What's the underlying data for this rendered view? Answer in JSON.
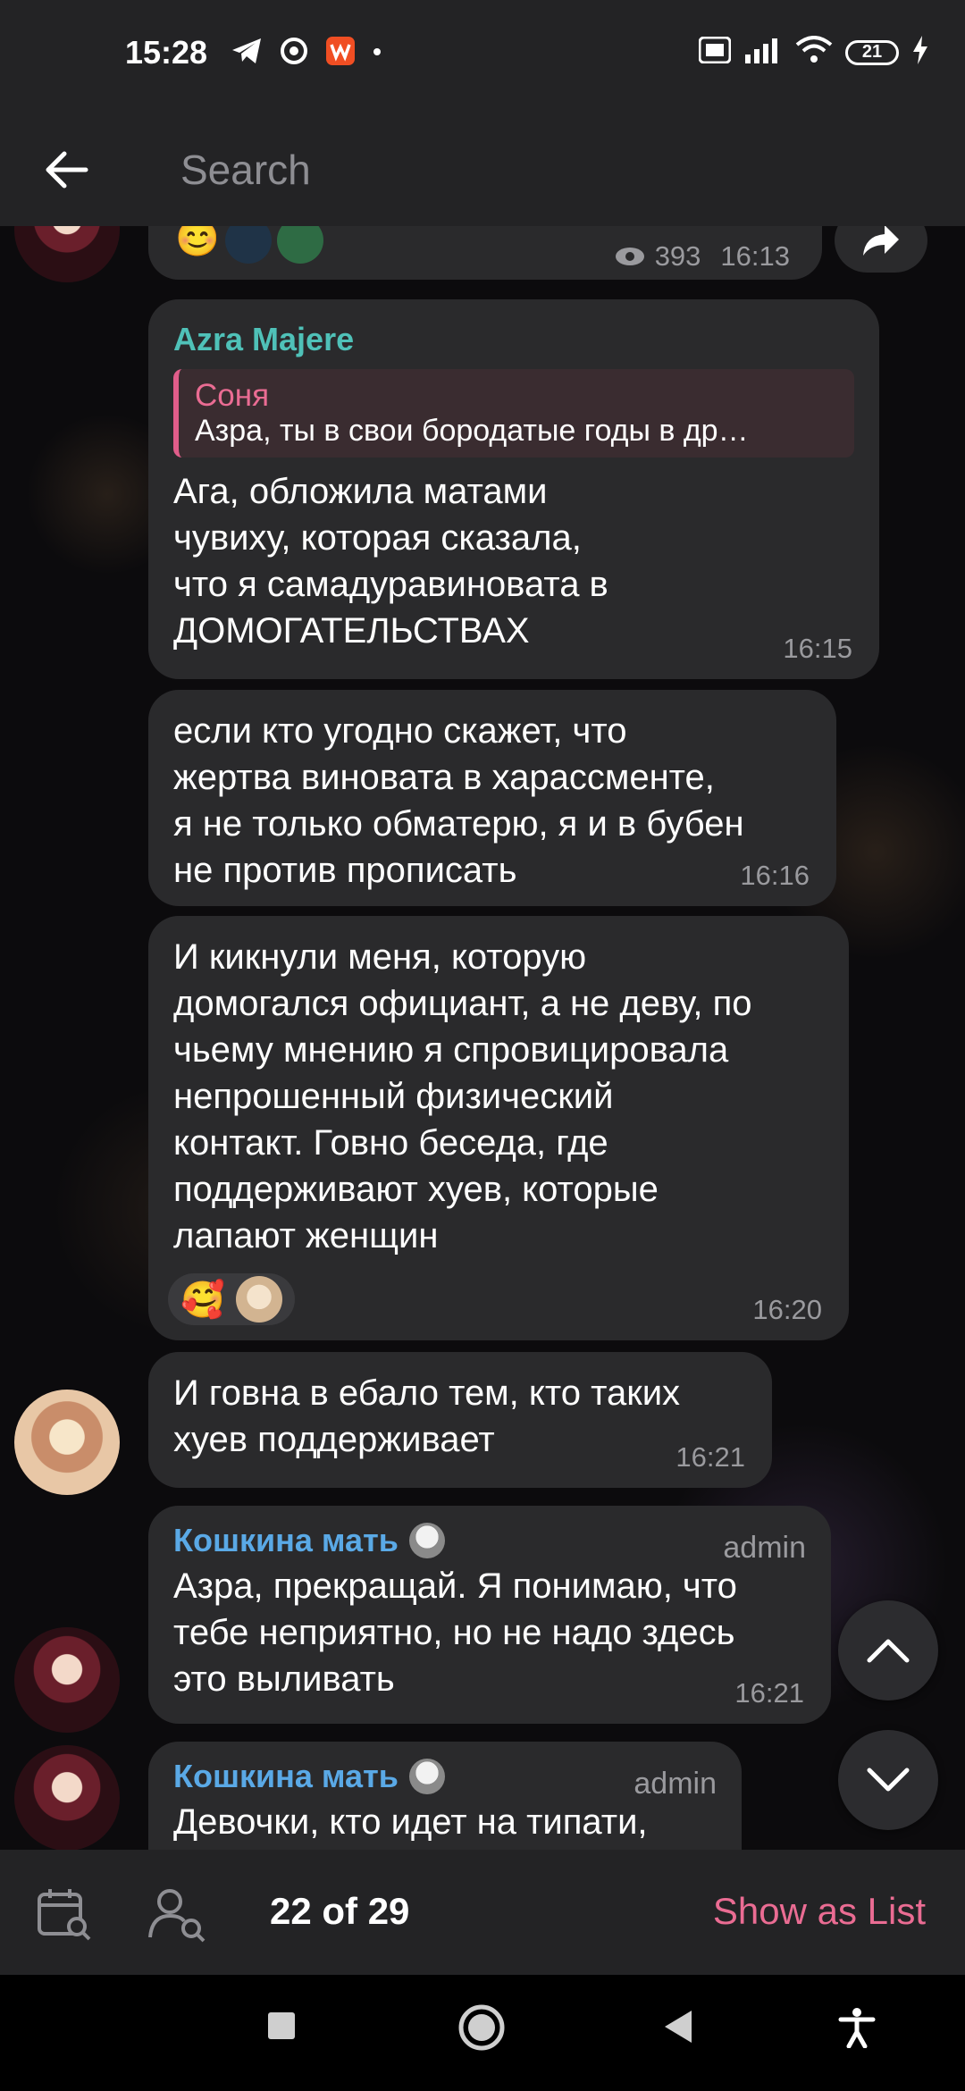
{
  "status_bar": {
    "time": "15:28",
    "battery": "21"
  },
  "header": {
    "search_placeholder": "Search"
  },
  "messages": {
    "m0": {
      "views": "393",
      "time": "16:13"
    },
    "m1": {
      "sender": "Azra Majere",
      "sender_color": "#4fc1b8",
      "quote_name": "Соня",
      "quote_text": "Азра, ты в свои бородатые годы в др…",
      "text": "Ага, обложила матами\nчувиху, которая сказала,\nчто я самадуравиновата в\nДОМОГАТЕЛЬСТВАХ",
      "time": "16:15"
    },
    "m2": {
      "text": "если кто угодно скажет, что\nжертва виновата в харассменте,\nя не только обматерю, я и в бубен\nне против прописать",
      "time": "16:16"
    },
    "m3": {
      "text": "И кикнули меня, которую\nдомогался официант, а не деву, по\nчьему мнению я спровицировала\nнепрошенный физический\nконтакт. Говно беседа, где\nподдерживают хуев, которые\nлапают женщин",
      "reaction_emoji": "🥰",
      "time": "16:20"
    },
    "m4": {
      "text": "И говна в ебало тем, кто таких\nхуев поддерживает",
      "time": "16:21"
    },
    "m5": {
      "sender": "Кошкина мать",
      "sender_color": "#5aa9e6",
      "role": "admin",
      "text": "Азра, прекращай. Я понимаю, что\nтебе неприятно, но не надо здесь\nэто выливать",
      "time": "16:21"
    },
    "m6": {
      "sender": "Кошкина мать",
      "role": "admin",
      "text": "Девочки, кто идет на типати,"
    }
  },
  "bottom_bar": {
    "counter": "22 of 29",
    "show_as_list": "Show as List"
  },
  "colors": {
    "accent_pink": "#ea6c93",
    "bubble": "#2a2a2c",
    "bar": "#232325"
  }
}
